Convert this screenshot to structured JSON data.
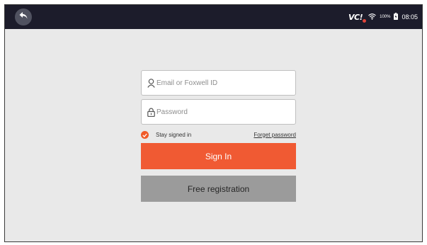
{
  "status_bar": {
    "vci_label": "VC!",
    "battery_percent": "100%",
    "time": "08:05"
  },
  "login": {
    "email_placeholder": "Email or Foxwell ID",
    "password_placeholder": "Password",
    "stay_signed_in": "Stay signed in",
    "stay_signed_in_checked": true,
    "forget_password": "Forget password",
    "sign_in": "Sign In",
    "free_registration": "Free registration"
  },
  "colors": {
    "accent": "#f05a33",
    "status_bar": "#1c1c2b",
    "background": "#e9e9e9",
    "register_button": "#9b9b9b"
  },
  "icons": {
    "back": "back-arrow-icon",
    "vci": "vci-status-icon",
    "wifi": "wifi-icon",
    "battery": "battery-icon",
    "user": "user-icon",
    "lock": "lock-icon",
    "check": "checkmark-icon"
  }
}
